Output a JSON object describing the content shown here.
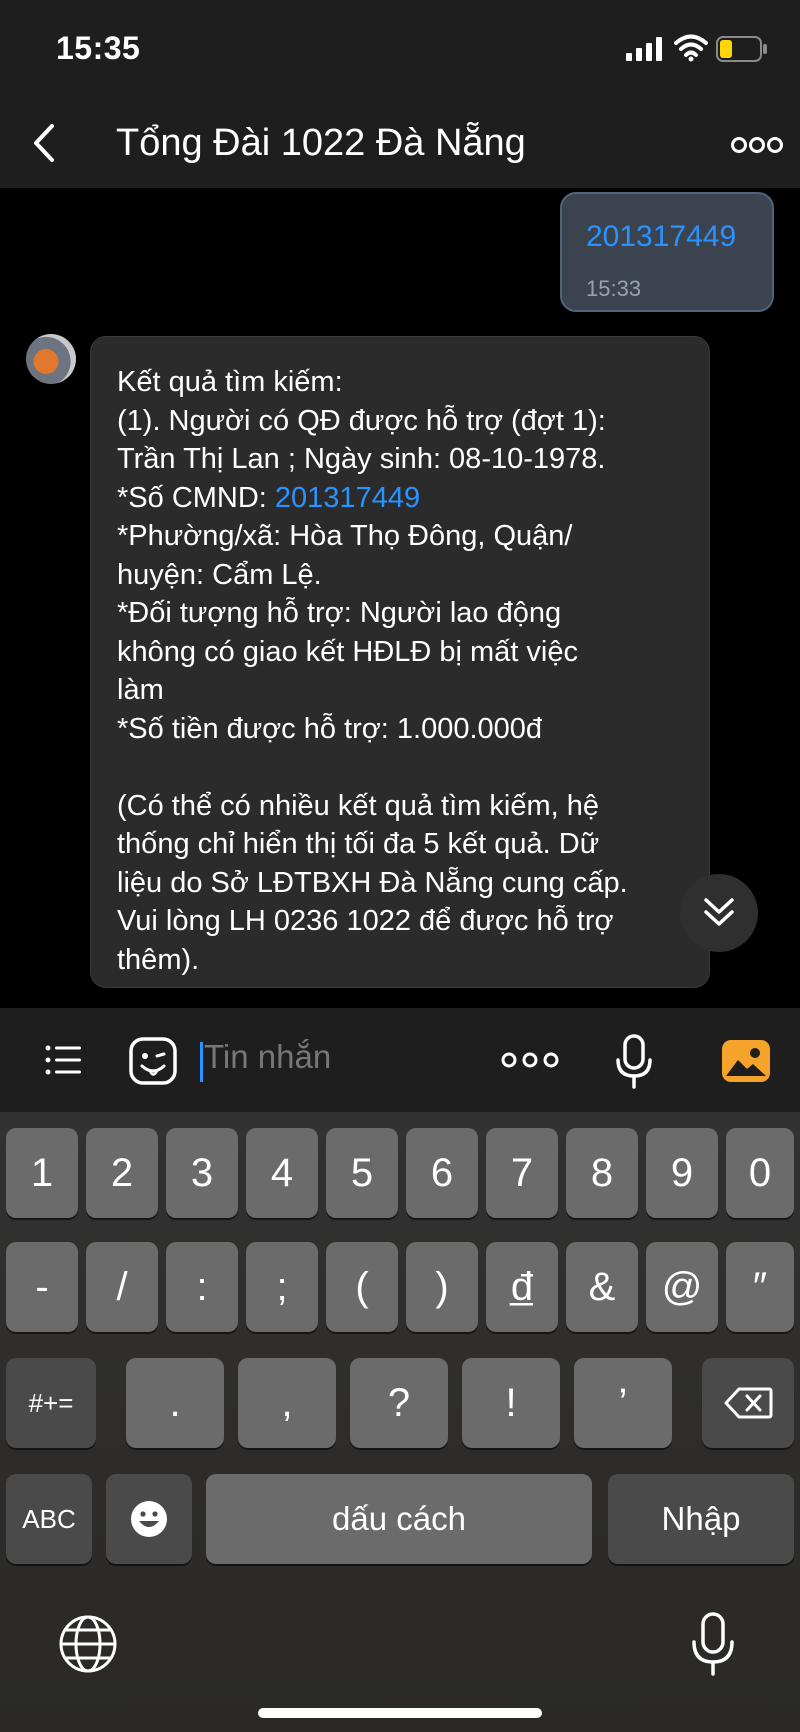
{
  "status_bar": {
    "time": "15:35"
  },
  "header": {
    "title": "Tổng Đài 1022 Đà Nẵng"
  },
  "outgoing_message": {
    "text": "201317449",
    "time": "15:33"
  },
  "incoming_message": {
    "lines": [
      "Kết quả tìm kiếm:",
      "(1). Người có QĐ được hỗ trợ (đợt 1):",
      "Trần Thị Lan ; Ngày sinh: 08-10-1978.",
      "*Số CMND: ",
      "*Phường/xã: Hòa Thọ Đông, Quận/",
      "huyện: Cẩm Lệ.",
      "*Đối tượng hỗ trợ: Người lao động",
      "không có giao kết HĐLĐ bị mất việc",
      "làm",
      "*Số tiền được hỗ trợ: 1.000.000đ",
      "(Có thể có nhiều kết quả tìm kiếm, hệ",
      "thống chỉ hiển thị tối đa 5 kết quả. Dữ",
      "liệu do Sở LĐTBXH Đà Nẵng cung cấp.",
      "Vui lòng LH 0236 1022 để được hỗ trợ",
      "thêm)."
    ],
    "id_link": "201317449"
  },
  "input_bar": {
    "placeholder": "Tin nhắn"
  },
  "keyboard": {
    "row1": [
      "1",
      "2",
      "3",
      "4",
      "5",
      "6",
      "7",
      "8",
      "9",
      "0"
    ],
    "row2": [
      "-",
      "/",
      ":",
      ";",
      "(",
      ")",
      "đ̲",
      "&",
      "@",
      "″"
    ],
    "row3": [
      "#+=",
      ".",
      ",",
      "?",
      "!",
      "’"
    ],
    "row4": {
      "abc": "ABC",
      "space": "dấu cách",
      "enter": "Nhập"
    }
  },
  "colors": {
    "accent": "#2a93ff",
    "header_bg": "#1e1e1e",
    "bubble_in": "#2b2b2b",
    "bubble_out": "#3a434e",
    "photo_icon": "#f5a32b"
  }
}
